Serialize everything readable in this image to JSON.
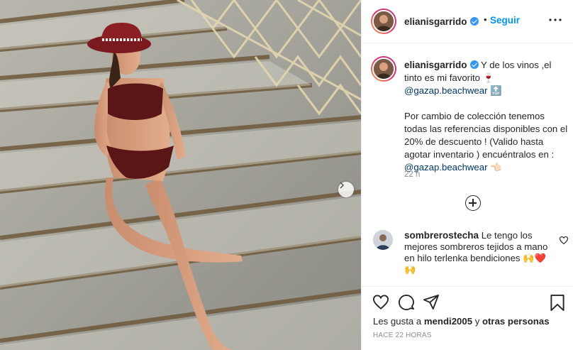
{
  "header": {
    "username": "elianisgarrido",
    "dot": "•",
    "follow_label": "Seguir",
    "more_icon": "more-horizontal-icon"
  },
  "caption": {
    "username": "elianisgarrido",
    "line1": "Y de los vinos ,el tinto es mi favorito",
    "wine_emoji": "🍷",
    "mention1": "@gazap.beachwear",
    "top_emoji": "🔝",
    "para2": "Por cambio de colección tenemos todas las referencias disponibles con el 20% de descuento ! (Valido hasta agotar inventario ) encuéntralos en :",
    "mention2": "@gazap.beachwear",
    "point_emoji": "👈🏻",
    "time": "22 h"
  },
  "load_more_icon": "plus-circle-icon",
  "comment": {
    "username": "sombrerostecha",
    "text": "Le tengo los mejores sombreros tejidos a mano en hilo terlenka bendiciones",
    "emojis": "🙌❤️ 🙌",
    "like_icon": "heart-outline-icon"
  },
  "actions": {
    "like_icon": "heart-icon",
    "comment_icon": "comment-icon",
    "share_icon": "share-icon",
    "save_icon": "bookmark-icon"
  },
  "likes": {
    "prefix": "Les gusta a",
    "user": "mendi2005",
    "connector": "y",
    "others": "otras personas"
  },
  "posted": "Hace 22 horas",
  "colors": {
    "accent": "#0095f6",
    "verified": "#3897f0",
    "mention": "#00376b",
    "muted": "#8e8e8e"
  }
}
